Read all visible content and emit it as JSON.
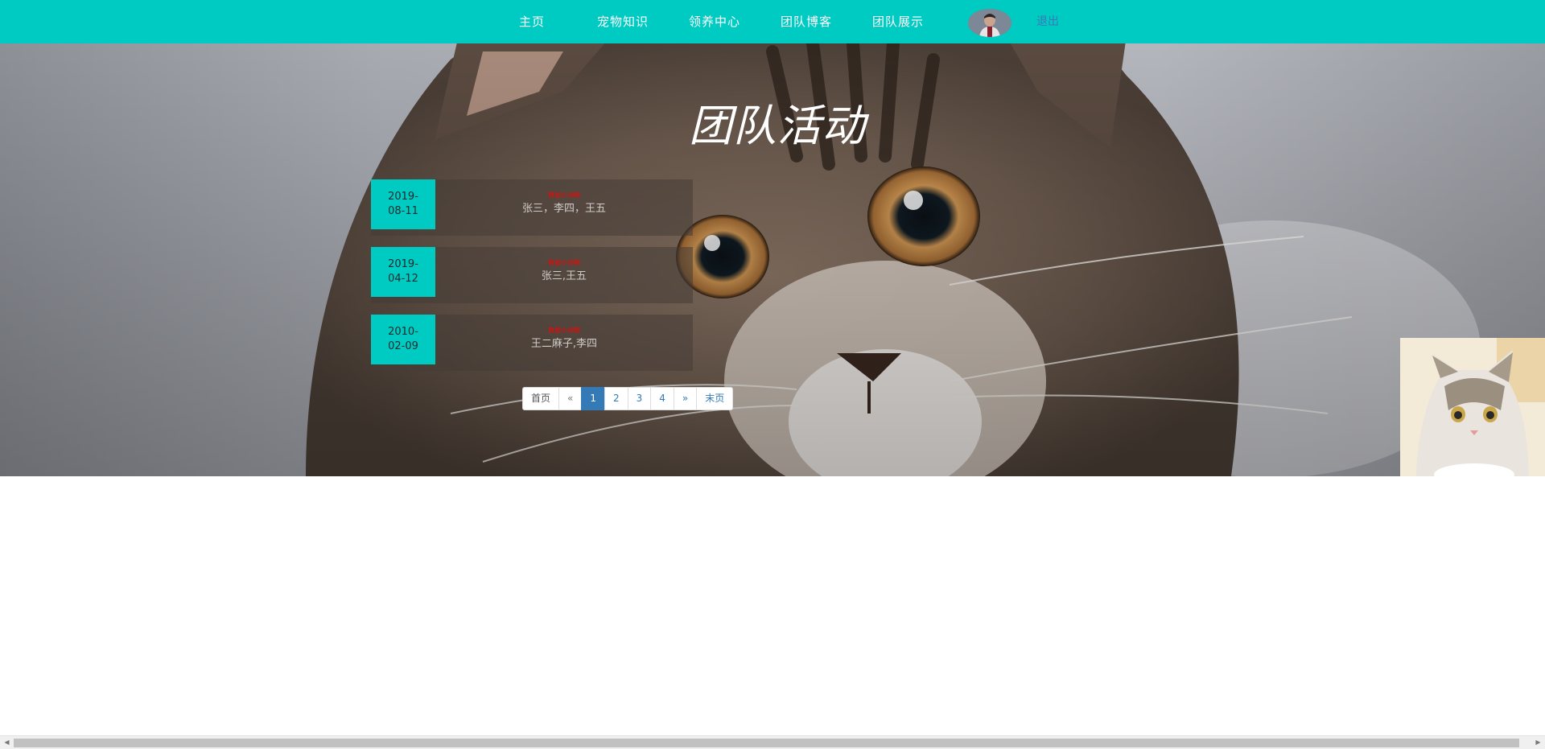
{
  "nav": {
    "items": [
      {
        "label": "主页"
      },
      {
        "label": "宠物知识"
      },
      {
        "label": "领养中心"
      },
      {
        "label": "团队博客"
      },
      {
        "label": "团队展示"
      }
    ],
    "logout": "退出",
    "accent": "#00cbc3"
  },
  "hero": {
    "title": "团队活动"
  },
  "activities": [
    {
      "date": "2019-\n08-11",
      "tag": "救助小动物",
      "names": "张三，李四，王五"
    },
    {
      "date": "2019-\n04-12",
      "tag": "救助小动物",
      "names": "张三,王五"
    },
    {
      "date": "2010-\n02-09",
      "tag": "救助小动物",
      "names": "王二麻子,李四"
    }
  ],
  "pagination": {
    "first": "首页",
    "prev": "«",
    "pages": [
      "1",
      "2",
      "3",
      "4"
    ],
    "current": "1",
    "next": "»",
    "last": "末页"
  },
  "scrollbar": {
    "left_arrow": "◀",
    "right_arrow": "▶"
  }
}
